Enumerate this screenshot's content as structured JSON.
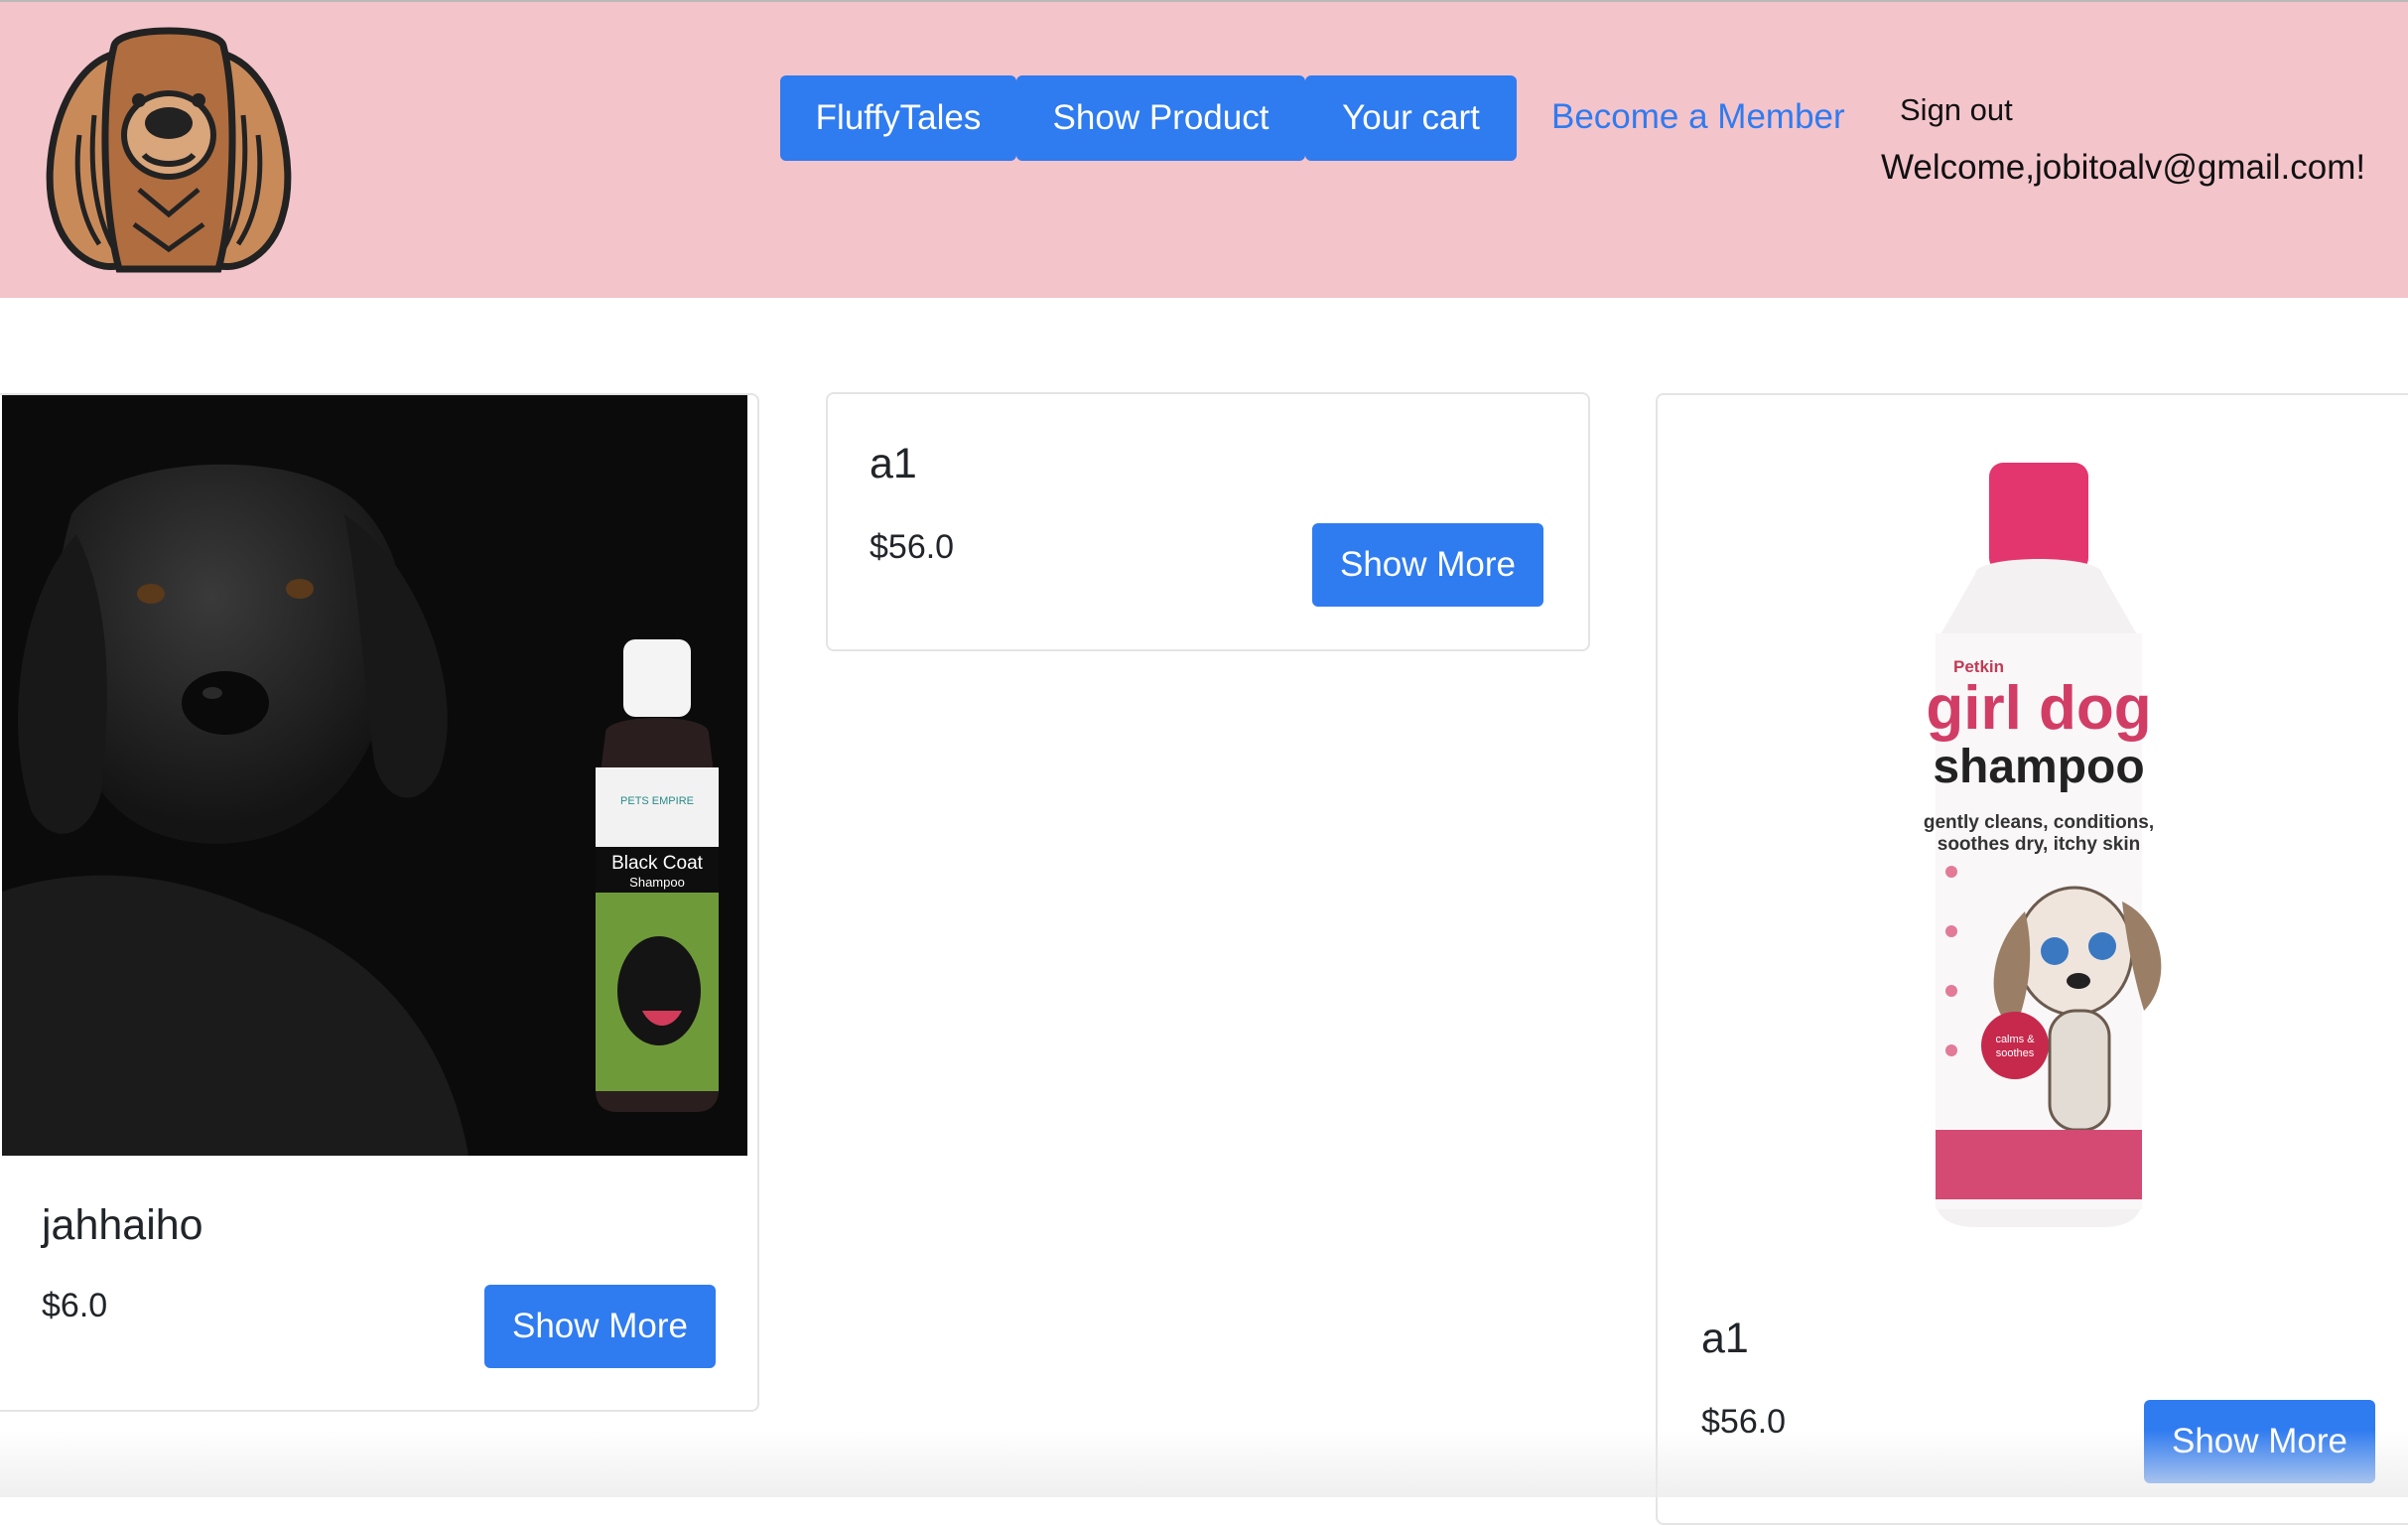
{
  "nav": {
    "logo_icon": "dog-face-icon",
    "buttons": [
      "FluffyTales",
      "Show Product",
      "Your cart"
    ],
    "member_link": "Become a Member",
    "sign_out": "Sign out",
    "welcome": "Welcome,jobitoalv@gmail.com!"
  },
  "colors": {
    "navbar_bg": "#f4c4cb",
    "accent": "#2f7bf0"
  },
  "products": [
    {
      "name": "jahhaiho",
      "price": "$6.0",
      "button": "Show More",
      "image": {
        "kind": "black-labrador-with-shampoo-bottle",
        "bottle_brand": "PETS EMPIRE",
        "bottle_title": "Black Coat",
        "bottle_subtitle": "Shampoo"
      }
    },
    {
      "name": "a1",
      "price": "$56.0",
      "button": "Show More"
    },
    {
      "name": "a1",
      "price": "$56.0",
      "button": "Show More",
      "image": {
        "kind": "pink-shampoo-bottle",
        "brand": "Petkin",
        "title_line1": "girl dog",
        "title_line2": "shampoo",
        "tagline_line1": "gently cleans, conditions,",
        "tagline_line2": "soothes dry, itchy skin",
        "badge_line1": "calms &",
        "badge_line2": "soothes"
      }
    }
  ]
}
